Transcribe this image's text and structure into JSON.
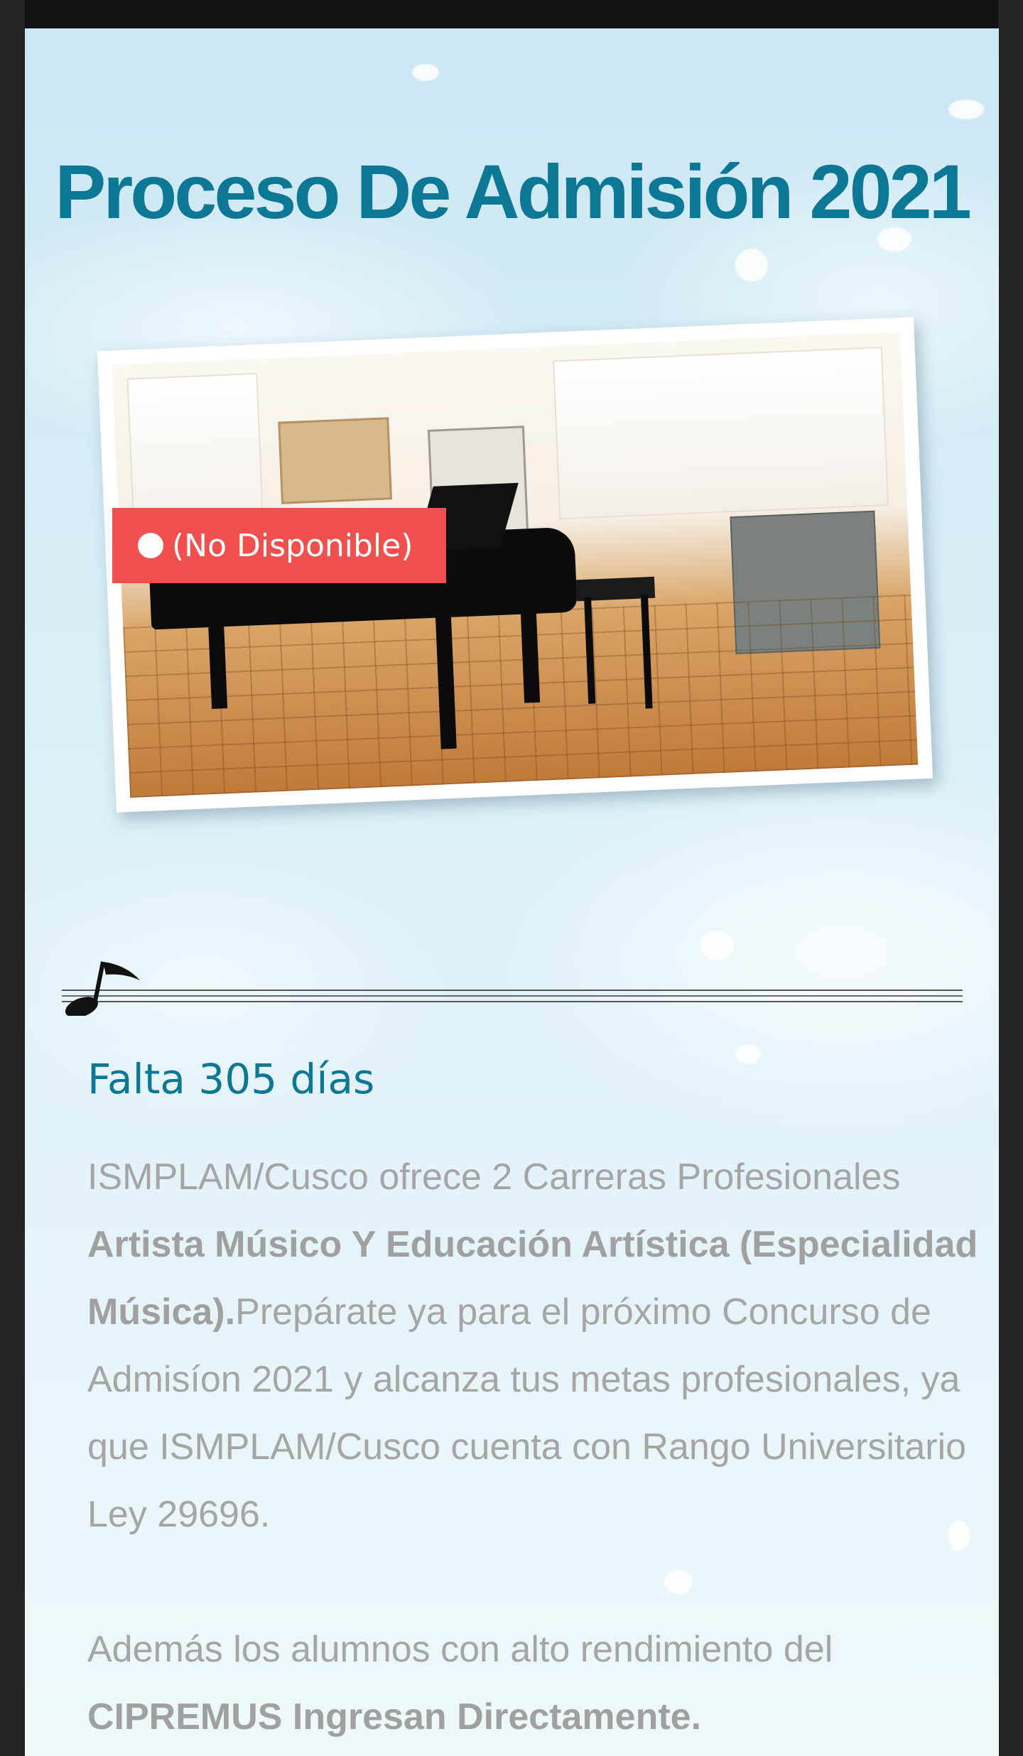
{
  "header": {
    "title": "Proceso De Admisión 2021"
  },
  "hero": {
    "status_badge": "(No Disponible)",
    "status_color": "#f2504f",
    "image_subject": "music-room-with-grand-piano"
  },
  "countdown": {
    "text": "Falta 305 días"
  },
  "description": {
    "intro": "ISMPLAM/Cusco ofrece 2 Carreras Profesionales ",
    "careers": "Artista Músico Y Educación Artística (Especialidad Música).",
    "rest": "Prepárate ya para el próximo Concurso de Admisíon 2021 y alcanza tus metas profesionales, ya que ISMPLAM/Cusco cuenta con Rango Universitario Ley 29696."
  },
  "note": {
    "intro": "Además los alumnos con alto rendimiento del ",
    "highlight": "CIPREMUS Ingresan Directamente."
  },
  "colors": {
    "accent": "#0d7796",
    "body_text": "#a5a5a5",
    "badge": "#f2504f"
  },
  "icons": {
    "divider": "music-note-icon"
  }
}
